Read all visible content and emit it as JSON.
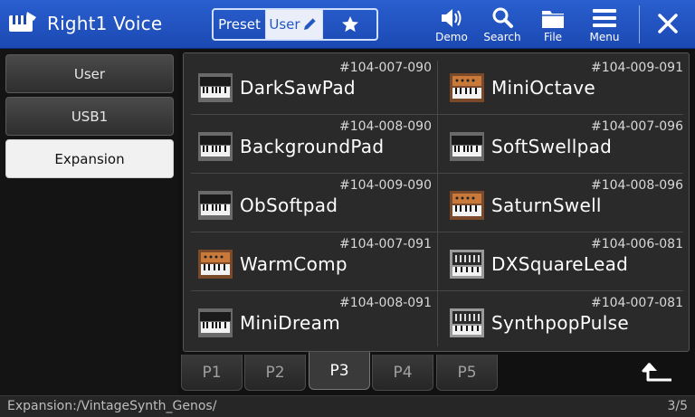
{
  "header": {
    "title": "Right1 Voice",
    "title_icon": "keyboard-hand-icon",
    "tabs": {
      "preset": "Preset",
      "user": "User"
    },
    "buttons": [
      {
        "id": "demo",
        "label": "Demo",
        "icon": "speaker-icon"
      },
      {
        "id": "search",
        "label": "Search",
        "icon": "search-icon"
      },
      {
        "id": "file",
        "label": "File",
        "icon": "folder-icon"
      },
      {
        "id": "menu",
        "label": "Menu",
        "icon": "menu-icon"
      }
    ]
  },
  "sidebar": {
    "items": [
      {
        "label": "User",
        "active": false
      },
      {
        "label": "USB1",
        "active": false
      },
      {
        "label": "Expansion",
        "active": true
      }
    ]
  },
  "voices": [
    {
      "number": "#104-007-090",
      "name": "DarkSawPad",
      "thumb": "keyboard-thumb-icon"
    },
    {
      "number": "#104-009-091",
      "name": "MiniOctave",
      "thumb": "analog-synth-thumb-icon"
    },
    {
      "number": "#104-008-090",
      "name": "BackgroundPad",
      "thumb": "keyboard-thumb-icon"
    },
    {
      "number": "#104-007-096",
      "name": "SoftSwellpad",
      "thumb": "keyboard-thumb-icon"
    },
    {
      "number": "#104-009-090",
      "name": "ObSoftpad",
      "thumb": "keyboard-thumb-icon"
    },
    {
      "number": "#104-008-096",
      "name": "SaturnSwell",
      "thumb": "analog-synth-thumb-icon"
    },
    {
      "number": "#104-007-091",
      "name": "WarmComp",
      "thumb": "analog-synth-thumb-icon"
    },
    {
      "number": "#104-006-081",
      "name": "DXSquareLead",
      "thumb": "dx-synth-thumb-icon"
    },
    {
      "number": "#104-008-091",
      "name": "MiniDream",
      "thumb": "keyboard-thumb-icon"
    },
    {
      "number": "#104-007-081",
      "name": "SynthpopPulse",
      "thumb": "dx-synth-thumb-icon"
    }
  ],
  "pages": [
    "P1",
    "P2",
    "P3",
    "P4",
    "P5"
  ],
  "active_page": "P3",
  "status": {
    "path": "Expansion:/VintageSynth_Genos/",
    "page_count": "3/5"
  },
  "colors": {
    "header": "#2358c6",
    "panel": "#2a2a2a",
    "active": "#f1f1f1"
  }
}
